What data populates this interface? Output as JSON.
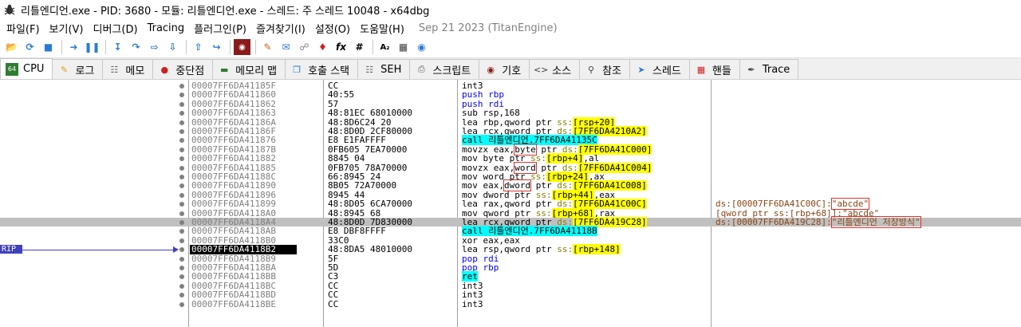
{
  "title": "리틀엔디언.exe - PID: 3680 - 모듈: 리틀엔디언.exe - 스레드: 주 스레드 10048 - x64dbg",
  "menu": [
    "파일(F)",
    "보기(V)",
    "디버그(D)",
    "Tracing",
    "플러그인(P)",
    "즐겨찾기(I)",
    "설정(O)",
    "도움말(H)"
  ],
  "build_date": "Sep 21 2023 (TitanEngine)",
  "tabs": [
    {
      "label": "CPU",
      "icon": "cpu-icon",
      "active": true
    },
    {
      "label": "로그",
      "icon": "log-icon"
    },
    {
      "label": "메모",
      "icon": "notes-icon"
    },
    {
      "label": "중단점",
      "icon": "breakpoint-icon"
    },
    {
      "label": "메모리 맵",
      "icon": "memory-map-icon"
    },
    {
      "label": "호출 스택",
      "icon": "call-stack-icon"
    },
    {
      "label": "SEH",
      "icon": "seh-icon"
    },
    {
      "label": "스크립트",
      "icon": "script-icon"
    },
    {
      "label": "기호",
      "icon": "symbols-icon"
    },
    {
      "label": "소스",
      "icon": "source-icon"
    },
    {
      "label": "참조",
      "icon": "references-icon"
    },
    {
      "label": "스레드",
      "icon": "threads-icon"
    },
    {
      "label": "핸들",
      "icon": "handles-icon"
    },
    {
      "label": "Trace",
      "icon": "trace-icon"
    }
  ],
  "rip_label": "RIP",
  "rows": [
    {
      "addr": "00007FF6DA41185F",
      "bytes": "CC",
      "dis": [
        [
          "k-int",
          "int3"
        ]
      ]
    },
    {
      "addr": "00007FF6DA411860",
      "bytes": "40:55",
      "dis": [
        [
          "k-push",
          "push rbp"
        ]
      ]
    },
    {
      "addr": "00007FF6DA411862",
      "bytes": "57",
      "dis": [
        [
          "k-push",
          "push rdi"
        ]
      ]
    },
    {
      "addr": "00007FF6DA411863",
      "bytes": "48:81EC 68010000",
      "dis": [
        [
          "k-mov",
          "sub rsp,168"
        ]
      ]
    },
    {
      "addr": "00007FF6DA41186A",
      "bytes": "48:8D6C24 20",
      "dis": [
        [
          "k-lea",
          "lea rbp,qword ptr "
        ],
        [
          "seg",
          "ss:"
        ],
        [
          "brhl",
          "[rsp+20]"
        ]
      ]
    },
    {
      "addr": "00007FF6DA41186F",
      "bytes": "48:8D0D 2CF80000",
      "dis": [
        [
          "k-lea",
          "lea rcx,qword ptr "
        ],
        [
          "seg",
          "ds:"
        ],
        [
          "brhl",
          "[7FF6DA4210A2]"
        ]
      ]
    },
    {
      "addr": "00007FF6DA411876",
      "bytes": "E8 E1FAFFFF",
      "dis": [
        [
          "k-call",
          "call 리틀엔디언.7FF6DA41135C"
        ]
      ]
    },
    {
      "addr": "00007FF6DA41187B",
      "bytes": "0FB605 7EA70000",
      "dis": [
        [
          "k-mov",
          "movzx eax,"
        ],
        [
          "box",
          "byte"
        ],
        [
          "k-mov",
          " ptr "
        ],
        [
          "seg",
          "ds:"
        ],
        [
          "brhl",
          "[7FF6DA41C000]"
        ]
      ]
    },
    {
      "addr": "00007FF6DA411882",
      "bytes": "8845 04",
      "dis": [
        [
          "k-mov",
          "mov byte ptr "
        ],
        [
          "seg",
          "ss:"
        ],
        [
          "brhl",
          "[rbp+4]"
        ],
        [
          "k-mov",
          ",al"
        ]
      ]
    },
    {
      "addr": "00007FF6DA411885",
      "bytes": "0FB705 78A70000",
      "dis": [
        [
          "k-mov",
          "movzx eax,"
        ],
        [
          "box",
          "word"
        ],
        [
          "k-mov",
          " ptr "
        ],
        [
          "seg",
          "ds:"
        ],
        [
          "brhl",
          "[7FF6DA41C004]"
        ]
      ]
    },
    {
      "addr": "00007FF6DA41188C",
      "bytes": "66:8945 24",
      "dis": [
        [
          "k-mov",
          "mov word ptr "
        ],
        [
          "seg",
          "ss:"
        ],
        [
          "brhl",
          "[rbp+24]"
        ],
        [
          "k-mov",
          ",ax"
        ]
      ]
    },
    {
      "addr": "00007FF6DA411890",
      "bytes": "8B05 72A70000",
      "dis": [
        [
          "k-mov",
          "mov eax,"
        ],
        [
          "box",
          "dword"
        ],
        [
          "k-mov",
          " ptr "
        ],
        [
          "seg",
          "ds:"
        ],
        [
          "brhl",
          "[7FF6DA41C008]"
        ]
      ]
    },
    {
      "addr": "00007FF6DA411896",
      "bytes": "8945 44",
      "dis": [
        [
          "k-mov",
          "mov dword ptr "
        ],
        [
          "seg",
          "ss:"
        ],
        [
          "brhl",
          "[rbp+44]"
        ],
        [
          "k-mov",
          ",eax"
        ]
      ]
    },
    {
      "addr": "00007FF6DA411899",
      "bytes": "48:8D05 6CA70000",
      "dis": [
        [
          "k-lea",
          "lea rax,qword ptr "
        ],
        [
          "seg",
          "ds:"
        ],
        [
          "brhl",
          "[7FF6DA41C00C]"
        ]
      ],
      "cmt": [
        [
          "plain",
          "ds:[00007FF6DA41C00C]:"
        ],
        [
          "box",
          "\"abcde\""
        ]
      ]
    },
    {
      "addr": "00007FF6DA4118A0",
      "bytes": "48:8945 68",
      "dis": [
        [
          "k-mov",
          "mov qword ptr "
        ],
        [
          "seg",
          "ss:"
        ],
        [
          "brhl",
          "[rbp+68]"
        ],
        [
          "k-mov",
          ",rax"
        ]
      ],
      "cmt": [
        [
          "plain",
          "[qword ptr ss:[rbp+68]]:\"abcde\""
        ]
      ]
    },
    {
      "addr": "00007FF6DA4118A4",
      "bytes": "48:8D0D 7D830000",
      "dis": [
        [
          "k-lea",
          "lea rcx,qword ptr "
        ],
        [
          "seg",
          "ds:"
        ],
        [
          "brhl",
          "[7FF6DA419C28]"
        ]
      ],
      "cmt": [
        [
          "plain",
          "ds:[00007FF6DA419C28]:"
        ],
        [
          "box",
          "\"리틀엔디언 저장방식\""
        ]
      ],
      "hl": true
    },
    {
      "addr": "00007FF6DA4118AB",
      "bytes": "E8 DBF8FFFF",
      "dis": [
        [
          "k-call",
          "call 리틀엔디언.7FF6DA41118B"
        ]
      ]
    },
    {
      "addr": "00007FF6DA4118B0",
      "bytes": "33C0",
      "dis": [
        [
          "k-xor",
          "xor eax,eax"
        ]
      ]
    },
    {
      "addr": "00007FF6DA4118B2",
      "bytes": "48:8DA5 48010000",
      "dis": [
        [
          "k-lea",
          "lea rsp,qword ptr "
        ],
        [
          "seg",
          "ss:"
        ],
        [
          "brhl",
          "[rbp+148]"
        ]
      ],
      "rip": true
    },
    {
      "addr": "00007FF6DA4118B9",
      "bytes": "5F",
      "dis": [
        [
          "k-pop",
          "pop rdi"
        ]
      ]
    },
    {
      "addr": "00007FF6DA4118BA",
      "bytes": "5D",
      "dis": [
        [
          "k-pop",
          "pop rbp"
        ]
      ]
    },
    {
      "addr": "00007FF6DA4118BB",
      "bytes": "C3",
      "dis": [
        [
          "k-ret",
          "ret"
        ]
      ]
    },
    {
      "addr": "00007FF6DA4118BC",
      "bytes": "CC",
      "dis": [
        [
          "k-int",
          "int3"
        ]
      ]
    },
    {
      "addr": "00007FF6DA4118BD",
      "bytes": "CC",
      "dis": [
        [
          "k-int",
          "int3"
        ]
      ]
    },
    {
      "addr": "00007FF6DA4118BE",
      "bytes": "CC",
      "dis": [
        [
          "k-int",
          "int3"
        ]
      ]
    }
  ]
}
